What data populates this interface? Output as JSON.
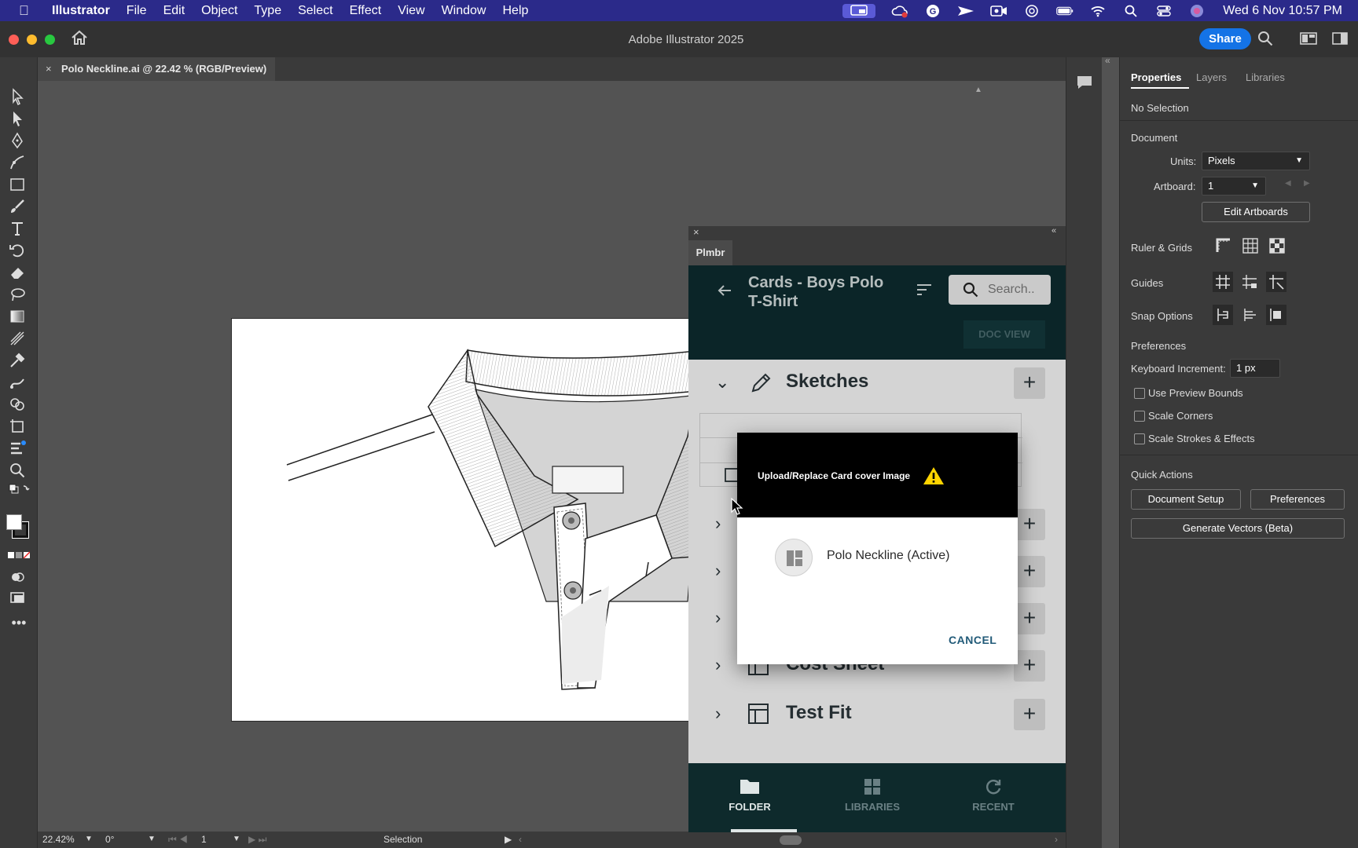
{
  "menubar": {
    "app_name": "Illustrator",
    "items": [
      "File",
      "Edit",
      "Object",
      "Type",
      "Select",
      "Effect",
      "View",
      "Window",
      "Help"
    ],
    "clock": "Wed 6 Nov  10:57 PM"
  },
  "window": {
    "title": "Adobe Illustrator 2025",
    "share_label": "Share"
  },
  "document_tab": {
    "close_glyph": "×",
    "label": "Polo Neckline.ai @ 22.42 % (RGB/Preview)"
  },
  "statusbar": {
    "zoom": "22.42%",
    "rotation": "0°",
    "artboard": "1",
    "mode": "Selection"
  },
  "properties": {
    "tabs": [
      "Properties",
      "Layers",
      "Libraries"
    ],
    "selection": "No Selection",
    "document_heading": "Document",
    "units_label": "Units:",
    "units_value": "Pixels",
    "artboard_label": "Artboard:",
    "artboard_value": "1",
    "edit_artboards": "Edit Artboards",
    "ruler_grids": "Ruler & Grids",
    "guides": "Guides",
    "snap_options": "Snap Options",
    "preferences_heading": "Preferences",
    "keyboard_increment_label": "Keyboard Increment:",
    "keyboard_increment_value": "1 px",
    "use_preview_bounds": "Use Preview Bounds",
    "scale_corners": "Scale Corners",
    "scale_strokes": "Scale Strokes & Effects",
    "quick_actions": "Quick Actions",
    "document_setup": "Document Setup",
    "preferences_btn": "Preferences",
    "generate_vectors": "Generate Vectors (Beta)"
  },
  "plmbr": {
    "panel_name": "Plmbr",
    "title_line1": "Cards - Boys Polo",
    "title_line2": "T-Shirt",
    "search_placeholder": "Search..",
    "doc_view": "DOC VIEW",
    "sections": [
      "Sketches",
      "Cost Sheet",
      "Test Fit"
    ],
    "nav": [
      "FOLDER",
      "LIBRARIES",
      "RECENT"
    ]
  },
  "dialog": {
    "title": "Upload/Replace Card cover Image",
    "option": "Polo Neckline (Active)",
    "cancel": "CANCEL"
  },
  "colors": {
    "menubar": "#2b2a8a",
    "share": "#1473e6",
    "plmbr_dark": "#0d2b2e",
    "cancel": "#215a78",
    "warning": "#ffd400"
  }
}
